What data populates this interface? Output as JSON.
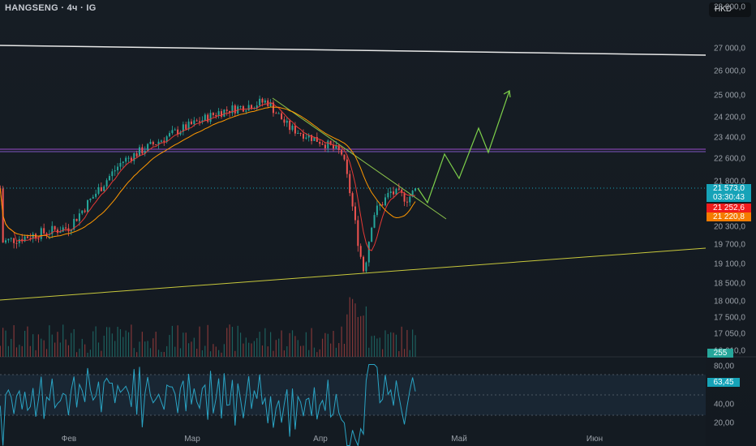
{
  "header": {
    "title": "HANGSENG · 4ч · IG",
    "currency": "HKD"
  },
  "price_axis": {
    "ticks": [
      "28 000,0",
      "27 000,0",
      "26 000,0",
      "25 000,0",
      "24 200,0",
      "23 400,0",
      "22 600,0",
      "21 800,0",
      "20 300,0",
      "19 700,0",
      "19 100,0",
      "18 500,0",
      "18 000,0",
      "17 500,0",
      "17 050,0",
      "16 610,0"
    ]
  },
  "tags": {
    "last_price": "21 573,0",
    "countdown": "03:30:43",
    "ma_fast": "21 252,6",
    "ma_slow": "21 220,8",
    "volume": "255",
    "rsi": "63,45"
  },
  "rsi_axis": {
    "ticks": [
      "80,00",
      "40,00",
      "20,00"
    ]
  },
  "time_axis": {
    "months": [
      "Фев",
      "Мар",
      "Апр",
      "Май",
      "Июн"
    ]
  },
  "colors": {
    "up": "#26a69a",
    "down": "#ef5350",
    "ma_fast": "#e53935",
    "ma_slow": "#ff9800",
    "rsi": "#2aa4c4",
    "last": "#16a3b8"
  },
  "chart_data": {
    "type": "candlestick",
    "symbol": "HANGSENG",
    "interval": "4ч",
    "price_path": [
      [
        -15,
        19800
      ],
      [
        0,
        20300
      ],
      [
        12,
        22500
      ],
      [
        25,
        23700
      ],
      [
        34,
        24400
      ],
      [
        45,
        24800
      ],
      [
        50,
        23800
      ],
      [
        58,
        23200
      ],
      [
        62,
        22800
      ],
      [
        64,
        21300
      ],
      [
        66,
        19500
      ],
      [
        67,
        18850
      ],
      [
        69,
        20700
      ],
      [
        73,
        21450
      ],
      [
        77,
        21250
      ],
      [
        79,
        21573
      ]
    ],
    "last_price": 21573.0,
    "rsi_last": 63.45
  }
}
